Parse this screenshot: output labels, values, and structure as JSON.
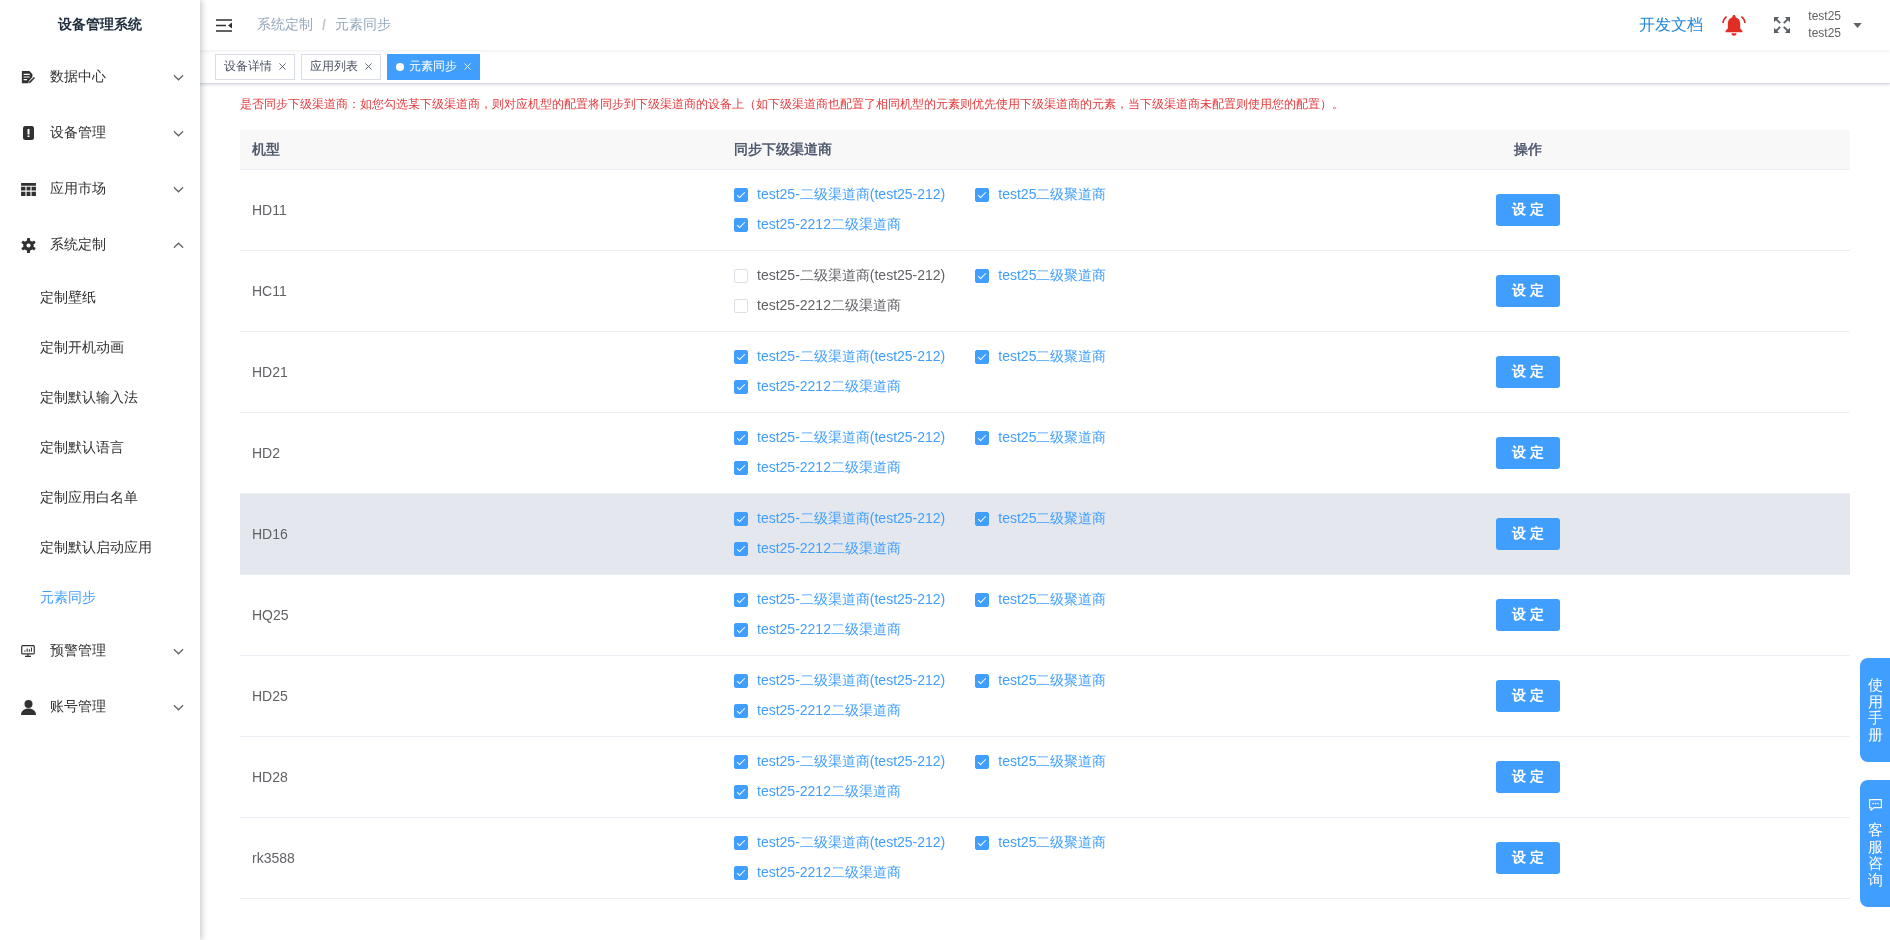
{
  "sidebar": {
    "title": "设备管理系统",
    "items": [
      {
        "label": "数据中心",
        "expanded": false
      },
      {
        "label": "设备管理",
        "expanded": false
      },
      {
        "label": "应用市场",
        "expanded": false
      },
      {
        "label": "系统定制",
        "expanded": true,
        "children": [
          {
            "label": "定制壁纸",
            "selected": false
          },
          {
            "label": "定制开机动画",
            "selected": false
          },
          {
            "label": "定制默认输入法",
            "selected": false
          },
          {
            "label": "定制默认语言",
            "selected": false
          },
          {
            "label": "定制应用白名单",
            "selected": false
          },
          {
            "label": "定制默认启动应用",
            "selected": false
          },
          {
            "label": "元素同步",
            "selected": true
          }
        ]
      },
      {
        "label": "预警管理",
        "expanded": false
      },
      {
        "label": "账号管理",
        "expanded": false
      }
    ]
  },
  "header": {
    "breadcrumb": {
      "items": [
        "系统定制",
        "元素同步"
      ],
      "separator": "/"
    },
    "docs_link": "开发文档",
    "user": {
      "name": "test25",
      "account": "test25"
    }
  },
  "tabs": [
    {
      "label": "设备详情",
      "selected": false
    },
    {
      "label": "应用列表",
      "selected": false
    },
    {
      "label": "元素同步",
      "selected": true
    }
  ],
  "notice": "是否同步下级渠道商：如您勾选某下级渠道商，则对应机型的配置将同步到下级渠道商的设备上（如下级渠道商也配置了相同机型的元素则优先使用下级渠道商的元素，当下级渠道商未配置则使用您的配置）。",
  "table": {
    "columns": [
      "机型",
      "同步下级渠道商",
      "操作"
    ],
    "rows": [
      {
        "model": "HD11",
        "highlighted": false,
        "channels": [
          {
            "label": "test25-二级渠道商(test25-212)",
            "checked": true
          },
          {
            "label": "test25二级聚道商",
            "checked": true
          },
          {
            "label": "test25-2212二级渠道商",
            "checked": true
          }
        ],
        "action": "设定"
      },
      {
        "model": "HC11",
        "highlighted": false,
        "channels": [
          {
            "label": "test25-二级渠道商(test25-212)",
            "checked": false
          },
          {
            "label": "test25二级聚道商",
            "checked": true
          },
          {
            "label": "test25-2212二级渠道商",
            "checked": false
          }
        ],
        "action": "设定"
      },
      {
        "model": "HD21",
        "highlighted": false,
        "channels": [
          {
            "label": "test25-二级渠道商(test25-212)",
            "checked": true
          },
          {
            "label": "test25二级聚道商",
            "checked": true
          },
          {
            "label": "test25-2212二级渠道商",
            "checked": true
          }
        ],
        "action": "设定"
      },
      {
        "model": "HD2",
        "highlighted": false,
        "channels": [
          {
            "label": "test25-二级渠道商(test25-212)",
            "checked": true
          },
          {
            "label": "test25二级聚道商",
            "checked": true
          },
          {
            "label": "test25-2212二级渠道商",
            "checked": true
          }
        ],
        "action": "设定"
      },
      {
        "model": "HD16",
        "highlighted": true,
        "channels": [
          {
            "label": "test25-二级渠道商(test25-212)",
            "checked": true
          },
          {
            "label": "test25二级聚道商",
            "checked": true
          },
          {
            "label": "test25-2212二级渠道商",
            "checked": true
          }
        ],
        "action": "设定"
      },
      {
        "model": "HQ25",
        "highlighted": false,
        "channels": [
          {
            "label": "test25-二级渠道商(test25-212)",
            "checked": true
          },
          {
            "label": "test25二级聚道商",
            "checked": true
          },
          {
            "label": "test25-2212二级渠道商",
            "checked": true
          }
        ],
        "action": "设定"
      },
      {
        "model": "HD25",
        "highlighted": false,
        "channels": [
          {
            "label": "test25-二级渠道商(test25-212)",
            "checked": true
          },
          {
            "label": "test25二级聚道商",
            "checked": true
          },
          {
            "label": "test25-2212二级渠道商",
            "checked": true
          }
        ],
        "action": "设定"
      },
      {
        "model": "HD28",
        "highlighted": false,
        "channels": [
          {
            "label": "test25-二级渠道商(test25-212)",
            "checked": true
          },
          {
            "label": "test25二级聚道商",
            "checked": true
          },
          {
            "label": "test25-2212二级渠道商",
            "checked": true
          }
        ],
        "action": "设定"
      },
      {
        "model": "rk3588",
        "highlighted": false,
        "channels": [
          {
            "label": "test25-二级渠道商(test25-212)",
            "checked": true
          },
          {
            "label": "test25二级聚道商",
            "checked": true
          },
          {
            "label": "test25-2212二级渠道商",
            "checked": true
          }
        ],
        "action": "设定"
      }
    ]
  },
  "float_buttons": [
    {
      "kind": "plain",
      "label": "使用手册"
    },
    {
      "kind": "chat",
      "label": "客服咨询"
    }
  ]
}
